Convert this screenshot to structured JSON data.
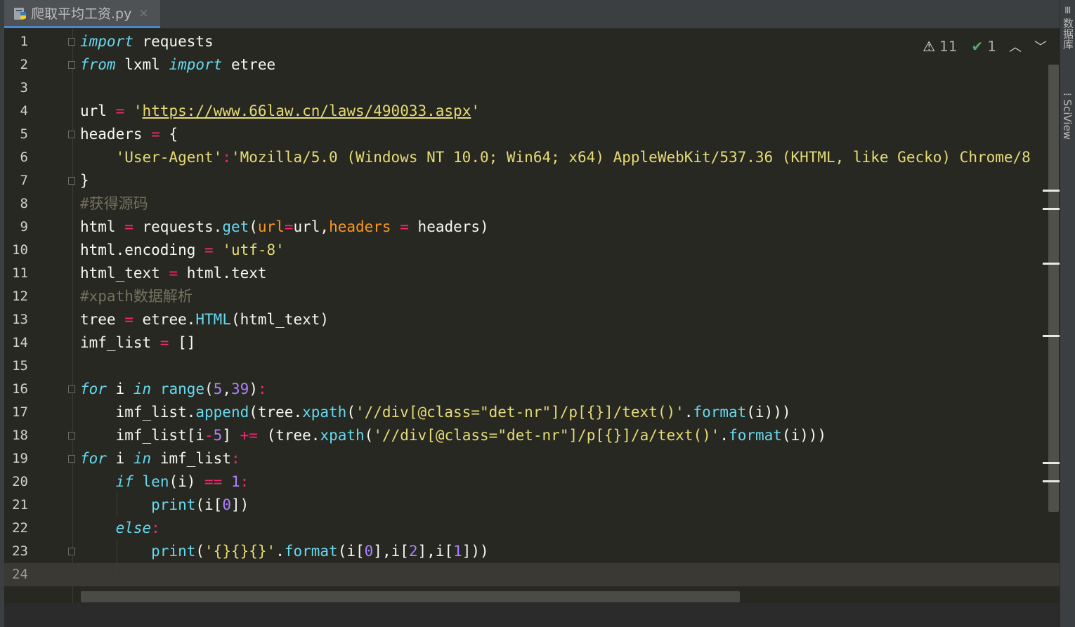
{
  "tab": {
    "title": "爬取平均工资.py",
    "close": "×",
    "icon": "python-file-icon"
  },
  "inspection": {
    "warnings": "11",
    "ok": "1",
    "warn_icon": "warning-triangle-icon",
    "ok_icon": "double-check-icon"
  },
  "right_panel": {
    "database": "数据库",
    "sciview": "SciView"
  },
  "editor": {
    "current_line": 24,
    "lines": [
      {
        "n": 1,
        "segments": [
          [
            "kw",
            "import"
          ],
          [
            "",
            " requests"
          ]
        ]
      },
      {
        "n": 2,
        "segments": [
          [
            "kw",
            "from"
          ],
          [
            "",
            " lxml "
          ],
          [
            "kw",
            "import"
          ],
          [
            "",
            " etree"
          ]
        ]
      },
      {
        "n": 3,
        "segments": []
      },
      {
        "n": 4,
        "segments": [
          [
            "",
            "url "
          ],
          [
            "op",
            "="
          ],
          [
            "",
            " "
          ],
          [
            "str",
            "'"
          ],
          [
            "url",
            "https://www.66law.cn/laws/490033.aspx"
          ],
          [
            "str",
            "'"
          ]
        ]
      },
      {
        "n": 5,
        "segments": [
          [
            "",
            "headers "
          ],
          [
            "op",
            "="
          ],
          [
            "",
            " {"
          ]
        ]
      },
      {
        "n": 6,
        "segments": [
          [
            "",
            "    "
          ],
          [
            "str",
            "'User-Agent'"
          ],
          [
            "op",
            ":"
          ],
          [
            "str",
            "'Mozilla/5.0 (Windows NT 10.0; Win64; x64) AppleWebKit/537.36 (KHTML, like Gecko) Chrome/8"
          ]
        ]
      },
      {
        "n": 7,
        "segments": [
          [
            "",
            "}"
          ]
        ]
      },
      {
        "n": 8,
        "segments": [
          [
            "cmt",
            "#获得源码"
          ]
        ]
      },
      {
        "n": 9,
        "segments": [
          [
            "",
            "html "
          ],
          [
            "op",
            "="
          ],
          [
            "",
            " requests."
          ],
          [
            "fn",
            "get"
          ],
          [
            "",
            "("
          ],
          [
            "param",
            "url"
          ],
          [
            "op",
            "="
          ],
          [
            "",
            "url,"
          ],
          [
            "param",
            "headers"
          ],
          [
            "",
            " "
          ],
          [
            "op",
            "="
          ],
          [
            "",
            " headers)"
          ]
        ]
      },
      {
        "n": 10,
        "segments": [
          [
            "",
            "html.encoding "
          ],
          [
            "op",
            "="
          ],
          [
            "",
            " "
          ],
          [
            "str",
            "'utf-8'"
          ]
        ]
      },
      {
        "n": 11,
        "segments": [
          [
            "",
            "html_text "
          ],
          [
            "op",
            "="
          ],
          [
            "",
            " html.text"
          ]
        ]
      },
      {
        "n": 12,
        "segments": [
          [
            "cmt",
            "#xpath数据解析"
          ]
        ]
      },
      {
        "n": 13,
        "segments": [
          [
            "",
            "tree "
          ],
          [
            "op",
            "="
          ],
          [
            "",
            " etree."
          ],
          [
            "fn",
            "HTML"
          ],
          [
            "",
            "(html_text)"
          ]
        ]
      },
      {
        "n": 14,
        "segments": [
          [
            "",
            "imf_list "
          ],
          [
            "op",
            "="
          ],
          [
            "",
            " []"
          ]
        ]
      },
      {
        "n": 15,
        "segments": []
      },
      {
        "n": 16,
        "segments": [
          [
            "kw",
            "for"
          ],
          [
            "",
            " i "
          ],
          [
            "kw",
            "in"
          ],
          [
            "",
            " "
          ],
          [
            "fn",
            "range"
          ],
          [
            "",
            "("
          ],
          [
            "num",
            "5"
          ],
          [
            "",
            ","
          ],
          [
            "num",
            "39"
          ],
          [
            "",
            ")"
          ],
          [
            "op",
            ":"
          ]
        ]
      },
      {
        "n": 17,
        "segments": [
          [
            "",
            "    imf_list."
          ],
          [
            "fn",
            "append"
          ],
          [
            "",
            "(tree."
          ],
          [
            "fn",
            "xpath"
          ],
          [
            "",
            "("
          ],
          [
            "str",
            "'//div[@class=\"det-nr\"]/p[{}]/text()'"
          ],
          [
            "",
            "."
          ],
          [
            "fn",
            "format"
          ],
          [
            "",
            "(i)))"
          ]
        ]
      },
      {
        "n": 18,
        "segments": [
          [
            "",
            "    imf_list[i"
          ],
          [
            "op",
            "-"
          ],
          [
            "num",
            "5"
          ],
          [
            "",
            "] "
          ],
          [
            "op",
            "+="
          ],
          [
            "",
            " (tree."
          ],
          [
            "fn",
            "xpath"
          ],
          [
            "",
            "("
          ],
          [
            "str",
            "'//div[@class=\"det-nr\"]/p[{}]/a/text()'"
          ],
          [
            "",
            "."
          ],
          [
            "fn",
            "format"
          ],
          [
            "",
            "(i)))"
          ]
        ]
      },
      {
        "n": 19,
        "segments": [
          [
            "kw",
            "for"
          ],
          [
            "",
            " i "
          ],
          [
            "kw",
            "in"
          ],
          [
            "",
            " imf_list"
          ],
          [
            "op",
            ":"
          ]
        ]
      },
      {
        "n": 20,
        "segments": [
          [
            "",
            "    "
          ],
          [
            "kw",
            "if"
          ],
          [
            "",
            " "
          ],
          [
            "fn",
            "len"
          ],
          [
            "",
            "(i) "
          ],
          [
            "op",
            "=="
          ],
          [
            "",
            " "
          ],
          [
            "num",
            "1"
          ],
          [
            "op",
            ":"
          ]
        ]
      },
      {
        "n": 21,
        "segments": [
          [
            "",
            "        "
          ],
          [
            "fn",
            "print"
          ],
          [
            "",
            "(i["
          ],
          [
            "num",
            "0"
          ],
          [
            "",
            "])"
          ]
        ]
      },
      {
        "n": 22,
        "segments": [
          [
            "",
            "    "
          ],
          [
            "kw",
            "else"
          ],
          [
            "op",
            ":"
          ]
        ]
      },
      {
        "n": 23,
        "segments": [
          [
            "",
            "        "
          ],
          [
            "fn",
            "print"
          ],
          [
            "",
            "("
          ],
          [
            "str",
            "'{}{}{}'"
          ],
          [
            "",
            "."
          ],
          [
            "fn",
            "format"
          ],
          [
            "",
            "(i["
          ],
          [
            "num",
            "0"
          ],
          [
            "",
            "],i["
          ],
          [
            "num",
            "2"
          ],
          [
            "",
            "],i["
          ],
          [
            "num",
            "1"
          ],
          [
            "",
            "]))"
          ]
        ]
      },
      {
        "n": 24,
        "segments": []
      }
    ]
  }
}
